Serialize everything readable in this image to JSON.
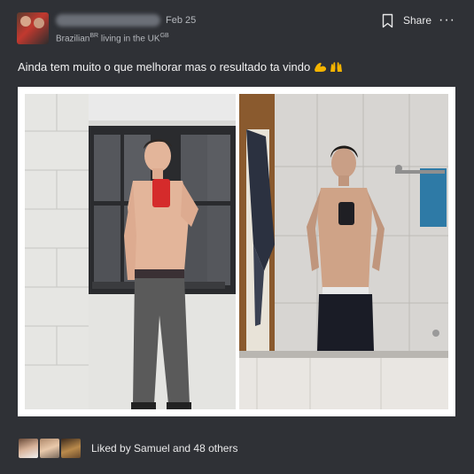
{
  "post": {
    "date": "Feb 25",
    "subtitle": "Brazilian",
    "subtitle_flag": "BR",
    "subtitle_location": " living in the UK",
    "subtitle_flag2": "GB",
    "text": "Ainda tem muito o que melhorar mas o resultado ta vindo",
    "emojis": [
      "flexed-biceps",
      "raising-hands"
    ]
  },
  "actions": {
    "share_label": "Share",
    "more_label": "···"
  },
  "footer": {
    "likes_text": "Liked by Samuel and 48 others"
  },
  "colors": {
    "background": "#2f3136",
    "text": "#e9e9ea",
    "muted": "#b5b8bd"
  }
}
